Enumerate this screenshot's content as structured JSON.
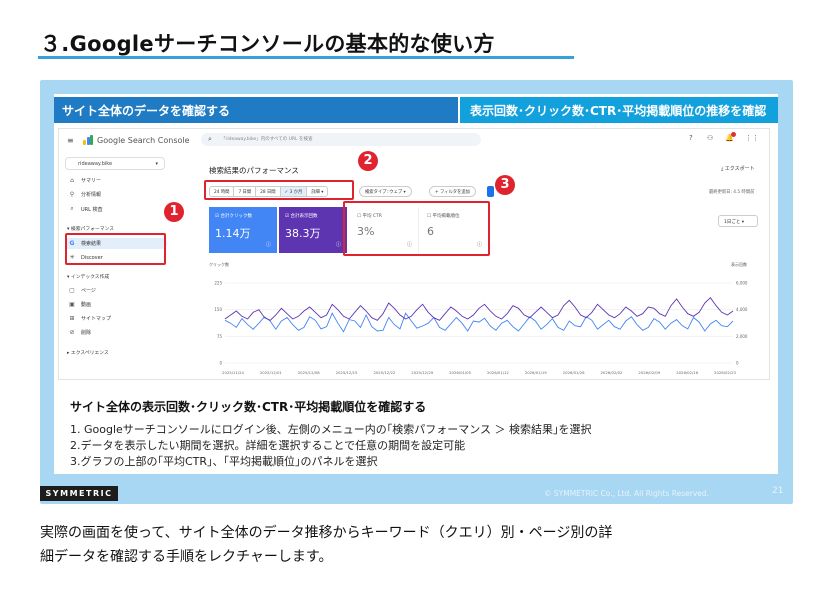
{
  "page": {
    "heading": "３.Googleサーチコンソールの基本的な使い方",
    "description_lines": [
      "実際の画面を使って、サイト全体のデータ推移からキーワード（クエリ）別・ページ別の詳",
      "細データを確認する手順をレクチャーします。"
    ]
  },
  "slide": {
    "band_left": "サイト全体のデータを確認する",
    "band_right": "表示回数･クリック数･CTR･平均掲載順位の推移を確認",
    "instructions_title": "サイト全体の表示回数･クリック数･CTR･平均掲載順位を確認する",
    "steps": [
      "1. Googleサーチコンソールにログイン後、左側のメニュー内の｢検索パフォーマンス ＞ 検索結果｣を選択",
      "2.データを表示したい期間を選択。詳細を選択することで任意の期間を設定可能",
      "3.グラフの上部の｢平均CTR｣、｢平均掲載順位｣のパネルを選択"
    ],
    "brand_logo": "SYMMETRIC",
    "copyright": "© SYMMETRIC Co., Ltd. All Rights Reserved.",
    "page_number": "21",
    "badges": [
      "1",
      "2",
      "3"
    ]
  },
  "gsc": {
    "menu_icon": "≡",
    "brand": "Google Search Console",
    "search_icon": "⌕",
    "search_placeholder": "「rideaway.bike」内のすべての URL を検査",
    "top_icons": [
      "?",
      "⚇",
      "🔔",
      "⋮⋮"
    ],
    "property": "rideaway.bike",
    "property_caret": "▾",
    "sidebar": {
      "items": [
        {
          "icon": "⌂",
          "label": "サマリー"
        },
        {
          "icon": "⚲",
          "label": "分析情報"
        },
        {
          "icon": "⌕",
          "label": "URL 検査"
        }
      ],
      "section_performance": "▾ 検索パフォーマンス",
      "active_icon": "G",
      "active_item": "検索結果",
      "discover_icon": "✳",
      "discover": "Discover",
      "section_index": "▾ インデックス作成",
      "index_items": [
        {
          "icon": "▢",
          "label": "ページ"
        },
        {
          "icon": "▣",
          "label": "動画"
        },
        {
          "icon": "⊞",
          "label": "サイトマップ"
        },
        {
          "icon": "⊘",
          "label": "削除"
        }
      ],
      "section_experience": "▸ エクスペリエンス"
    },
    "main_title": "検索結果のパフォーマンス",
    "export": "⤓ エクスポート",
    "date_ranges": [
      "24 時間",
      "7 日間",
      "28 日間",
      "✓ 3 か月",
      "詳細 ▾"
    ],
    "search_type_chip": "検索タイプ: ウェブ ▾",
    "add_filter_chip": "+ フィルタを追加",
    "last_update": "最終更新日: 4.5 時間前",
    "period_select": "1日ごと ▾",
    "metrics": [
      {
        "label": "☑ 合計クリック数",
        "value": "1.14万"
      },
      {
        "label": "☑ 合計表示回数",
        "value": "38.3万"
      },
      {
        "label": "☐ 平均 CTR",
        "value": "3%"
      },
      {
        "label": "☐ 平均掲載順位",
        "value": "6"
      }
    ],
    "help_icon": "ⓘ",
    "chart_data": {
      "type": "line",
      "left_axis_label": "クリック数",
      "right_axis_label": "表示回数",
      "left_ticks": [
        "225",
        "150",
        "75",
        "0"
      ],
      "right_ticks": [
        "6,000",
        "4,000",
        "2,000",
        "0"
      ],
      "left_ylim": [
        0,
        225
      ],
      "right_ylim": [
        0,
        6000
      ],
      "x_labels": [
        "2025/11/24",
        "2025/12/01",
        "2025/12/08",
        "2025/12/15",
        "2025/12/22",
        "2025/12/29",
        "2026/01/05",
        "2026/01/12",
        "2026/01/19",
        "2026/01/26",
        "2026/02/02",
        "2026/02/09",
        "2026/02/16",
        "2026/02/23"
      ],
      "series": [
        {
          "color": "#4285f4",
          "values": [
            120,
            112,
            100,
            125,
            108,
            95,
            112,
            130,
            118,
            95,
            118,
            128,
            108,
            92,
            100,
            130,
            120,
            96,
            102,
            140,
            112,
            88,
            122,
            118,
            100,
            135,
            102,
            90,
            92,
            128,
            108,
            96,
            140,
            118,
            98,
            104,
            112,
            128,
            100,
            92,
            110,
            128,
            112,
            90,
            118,
            115,
            126,
            104,
            92,
            112,
            120,
            102,
            90,
            110,
            130,
            118,
            95,
            108,
            125,
            100,
            92,
            118,
            105,
            102,
            130,
            120,
            95,
            108,
            120,
            102,
            95,
            118,
            130,
            108,
            92,
            100,
            125,
            115,
            95,
            112,
            122,
            105,
            96,
            128,
            115,
            90,
            110,
            120,
            105,
            102,
            118
          ]
        },
        {
          "color": "#5e35b1",
          "values": [
            3300,
            3600,
            3900,
            3500,
            3300,
            3800,
            4000,
            3400,
            3200,
            3600,
            4100,
            3700,
            3300,
            3500,
            3900,
            4200,
            3800,
            3400,
            3600,
            4400,
            4000,
            3500,
            3300,
            3800,
            4300,
            3900,
            3400,
            3200,
            3700,
            4500,
            4100,
            3600,
            3300,
            3500,
            4000,
            4400,
            3800,
            3400,
            3200,
            3700,
            4200,
            3900,
            3500,
            3300,
            3600,
            4100,
            4400,
            3900,
            3500,
            3300,
            3700,
            4300,
            4100,
            3600,
            3400,
            3800,
            4200,
            3800,
            3400,
            3600,
            4300,
            4700,
            4200,
            3600,
            3400,
            3800,
            4400,
            4000,
            3600,
            3400,
            3700,
            4200,
            3900,
            3500,
            3700,
            4200,
            4100,
            3700,
            3500,
            4300,
            4800,
            4200,
            3700,
            3500,
            3800,
            4500,
            4900,
            4300,
            3800,
            3600,
            3900
          ]
        }
      ]
    }
  }
}
